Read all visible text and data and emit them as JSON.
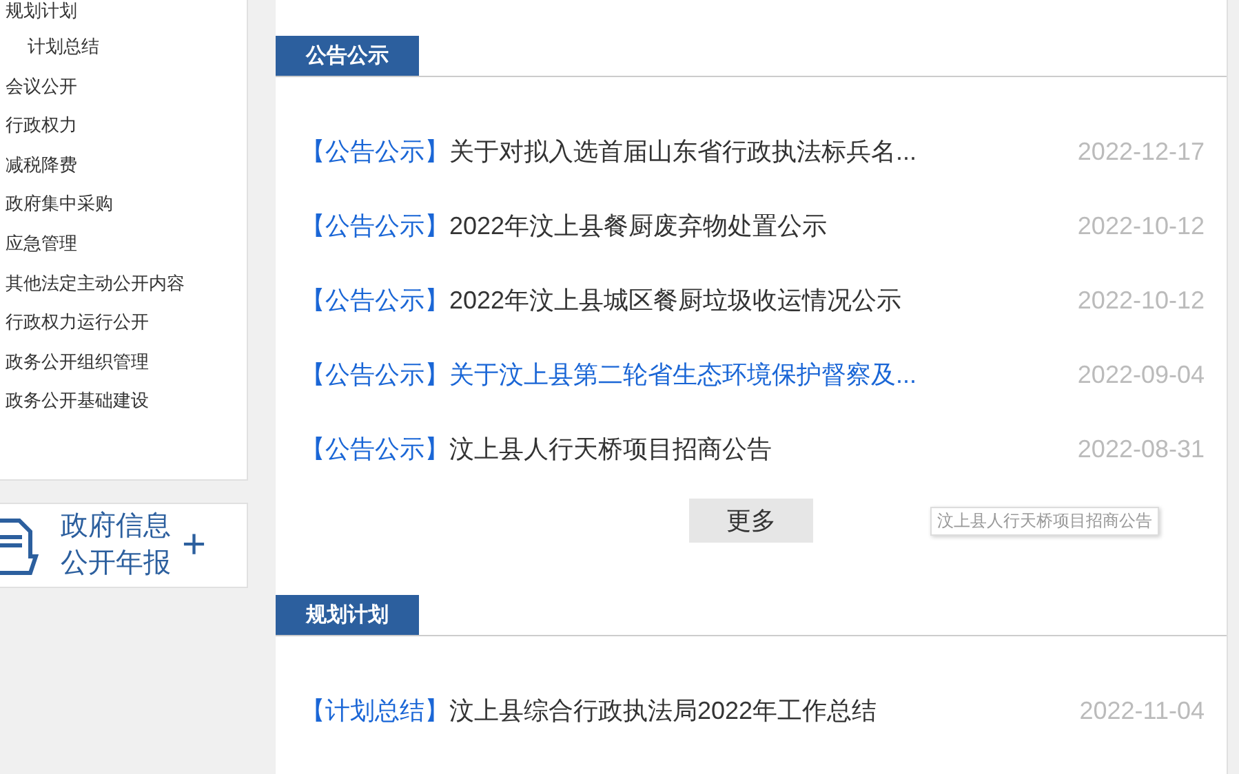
{
  "sidebar": {
    "items": [
      {
        "label": "规划计划",
        "children": [
          {
            "label": "计划总结"
          }
        ]
      },
      {
        "label": "会议公开"
      },
      {
        "label": "行政权力"
      },
      {
        "label": "减税降费"
      },
      {
        "label": "政府集中采购"
      },
      {
        "label": "应急管理"
      },
      {
        "label": "其他法定主动公开内容"
      },
      {
        "label": "行政权力运行公开"
      },
      {
        "label": "政务公开组织管理"
      },
      {
        "label": "政务公开基础建设"
      }
    ]
  },
  "annual_report": {
    "line_1": "政府信息",
    "line_2": "公开年报",
    "plus": "+"
  },
  "sections": [
    {
      "title": "公告公示",
      "items": [
        {
          "category": "【公告公示】",
          "title": "关于对拟入选首届山东省行政执法标兵名...",
          "date": "2022-12-17",
          "hovered": false
        },
        {
          "category": "【公告公示】",
          "title": "2022年汶上县餐厨废弃物处置公示",
          "date": "2022-10-12",
          "hovered": false
        },
        {
          "category": "【公告公示】",
          "title": "2022年汶上县城区餐厨垃圾收运情况公示",
          "date": "2022-10-12",
          "hovered": false
        },
        {
          "category": "【公告公示】",
          "title": "关于汶上县第二轮省生态环境保护督察及...",
          "date": "2022-09-04",
          "hovered": true
        },
        {
          "category": "【公告公示】",
          "title": "汶上县人行天桥项目招商公告",
          "date": "2022-08-31",
          "hovered": false
        }
      ],
      "more": "更多",
      "tooltip": "汶上县人行天桥项目招商公告"
    },
    {
      "title": "规划计划",
      "items": [
        {
          "category": "【计划总结】",
          "title": "汶上县综合行政执法局2022年工作总结",
          "date": "2022-11-04",
          "hovered": false
        }
      ]
    }
  ]
}
